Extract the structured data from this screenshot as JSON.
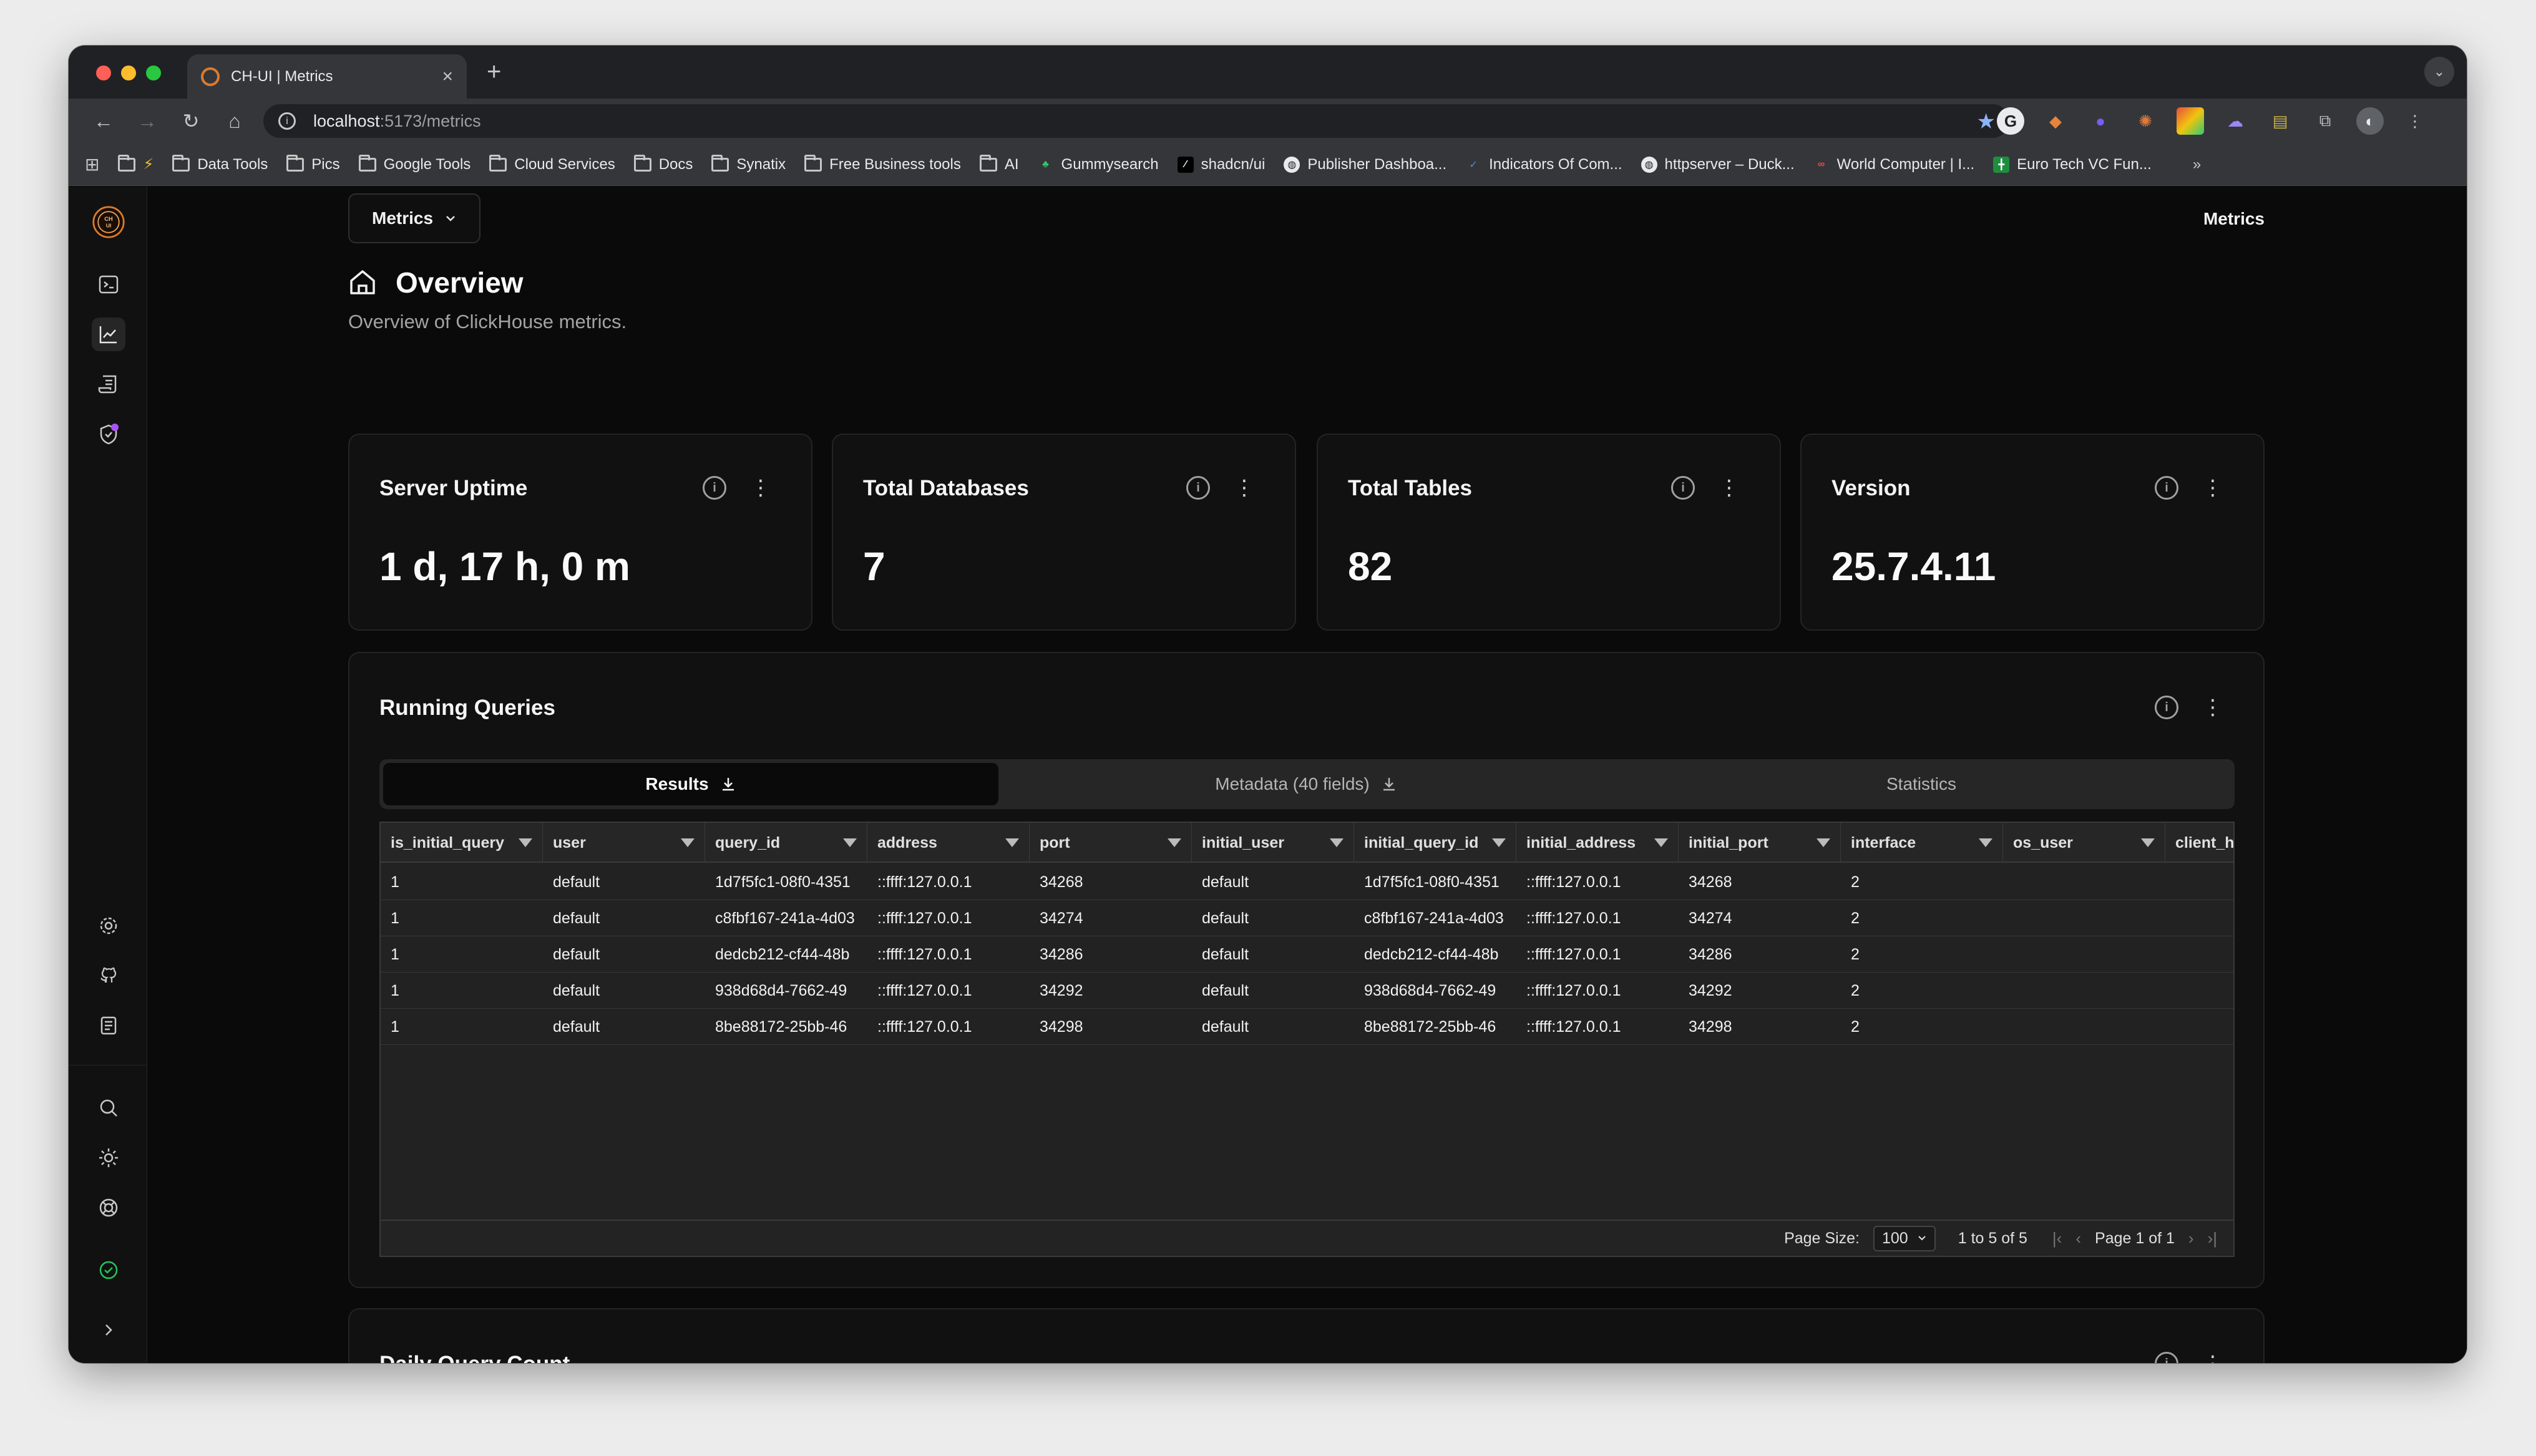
{
  "browser": {
    "tab_title": "CH-UI | Metrics",
    "url_host": "localhost",
    "url_path": ":5173/metrics",
    "bookmarks": [
      {
        "label": "Data Tools",
        "icon": "folder-icon"
      },
      {
        "label": "Pics",
        "icon": "folder-icon"
      },
      {
        "label": "Google Tools",
        "icon": "folder-icon"
      },
      {
        "label": "Cloud Services",
        "icon": "folder-icon"
      },
      {
        "label": "Docs",
        "icon": "folder-icon"
      },
      {
        "label": "Synatix",
        "icon": "folder-icon"
      },
      {
        "label": "Free Business tools",
        "icon": "folder-icon"
      },
      {
        "label": "AI",
        "icon": "folder-icon"
      },
      {
        "label": "Gummysearch",
        "icon": "gummy-icon"
      },
      {
        "label": "shadcn/ui",
        "icon": "shadcn-icon"
      },
      {
        "label": "Publisher Dashboa...",
        "icon": "globe-icon"
      },
      {
        "label": "Indicators Of Com...",
        "icon": "check-icon"
      },
      {
        "label": "httpserver – Duck...",
        "icon": "globe-icon"
      },
      {
        "label": "World Computer | I...",
        "icon": "infinity-icon"
      },
      {
        "label": "Euro Tech VC Fun...",
        "icon": "sheet-icon"
      }
    ]
  },
  "header": {
    "selector_label": "Metrics",
    "right_label": "Metrics"
  },
  "page": {
    "title": "Overview",
    "subtitle": "Overview of ClickHouse metrics."
  },
  "stats": [
    {
      "title": "Server Uptime",
      "value": "1 d, 17 h, 0 m"
    },
    {
      "title": "Total Databases",
      "value": "7"
    },
    {
      "title": "Total Tables",
      "value": "82"
    },
    {
      "title": "Version",
      "value": "25.7.4.11"
    }
  ],
  "running_queries": {
    "title": "Running Queries",
    "tabs": [
      "Results",
      "Metadata (40 fields)",
      "Statistics"
    ],
    "columns": [
      "is_initial_query",
      "user",
      "query_id",
      "address",
      "port",
      "initial_user",
      "initial_query_id",
      "initial_address",
      "initial_port",
      "interface",
      "os_user",
      "client_h"
    ],
    "rows": [
      [
        "1",
        "default",
        "1d7f5fc1-08f0-4351",
        "::ffff:127.0.0.1",
        "34268",
        "default",
        "1d7f5fc1-08f0-4351",
        "::ffff:127.0.0.1",
        "34268",
        "2",
        "",
        ""
      ],
      [
        "1",
        "default",
        "c8fbf167-241a-4d03",
        "::ffff:127.0.0.1",
        "34274",
        "default",
        "c8fbf167-241a-4d03",
        "::ffff:127.0.0.1",
        "34274",
        "2",
        "",
        ""
      ],
      [
        "1",
        "default",
        "dedcb212-cf44-48b",
        "::ffff:127.0.0.1",
        "34286",
        "default",
        "dedcb212-cf44-48b",
        "::ffff:127.0.0.1",
        "34286",
        "2",
        "",
        ""
      ],
      [
        "1",
        "default",
        "938d68d4-7662-49",
        "::ffff:127.0.0.1",
        "34292",
        "default",
        "938d68d4-7662-49",
        "::ffff:127.0.0.1",
        "34292",
        "2",
        "",
        ""
      ],
      [
        "1",
        "default",
        "8be88172-25bb-46",
        "::ffff:127.0.0.1",
        "34298",
        "default",
        "8be88172-25bb-46",
        "::ffff:127.0.0.1",
        "34298",
        "2",
        "",
        ""
      ]
    ],
    "footer": {
      "page_size_label": "Page Size:",
      "page_size_value": "100",
      "range": "1 to 5 of 5",
      "page": "Page 1 of 1"
    }
  },
  "daily_query_count": {
    "title": "Daily Query Count"
  },
  "colors": {
    "accent_logo": "#d97b2f",
    "status_ok": "#22c55e",
    "background": "#0a0a0a",
    "card": "#111111"
  }
}
